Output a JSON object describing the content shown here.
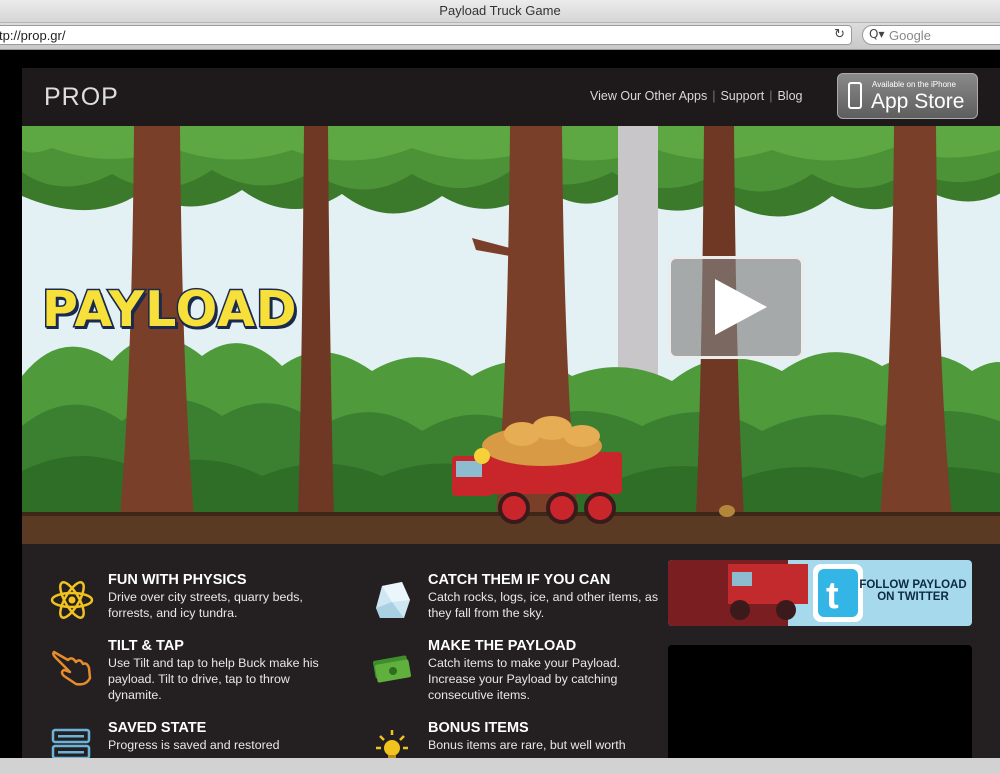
{
  "window": {
    "title": "Payload Truck Game"
  },
  "toolbar": {
    "url": "tp://prop.gr/",
    "search_placeholder": "Google"
  },
  "header": {
    "logo": "PROP",
    "nav": [
      "View Our Other Apps",
      "Support",
      "Blog"
    ],
    "appstore": {
      "small": "Available on the iPhone",
      "big": "App Store"
    }
  },
  "hero": {
    "game_title": "PAYLOAD"
  },
  "features": [
    {
      "title": "FUN WITH PHYSICS",
      "text": "Drive over city streets, quarry beds, forrests, and icy tundra.",
      "icon": "atom-icon"
    },
    {
      "title": "CATCH THEM IF YOU CAN",
      "text": "Catch rocks, logs, ice, and other items, as they fall from the sky.",
      "icon": "ice-cube-icon"
    },
    {
      "title": "TILT & TAP",
      "text": "Use Tilt and tap to help Buck make his payload. Tilt to drive, tap to throw dynamite.",
      "icon": "hand-tap-icon"
    },
    {
      "title": "MAKE THE PAYLOAD",
      "text": "Catch items to make your Payload. Increase your Payload by catching consecutive items.",
      "icon": "money-icon"
    },
    {
      "title": "SAVED STATE",
      "text": "Progress is saved and restored",
      "icon": "save-state-icon"
    },
    {
      "title": "BONUS ITEMS",
      "text": "Bonus items are rare, but well worth",
      "icon": "lightbulb-icon"
    }
  ],
  "twitter": {
    "text": "FOLLOW PAYLOAD ON TWITTER"
  },
  "colors": {
    "page_bg": "#242021",
    "title_yellow": "#f7e03a",
    "sky": "#e4f1f4"
  }
}
